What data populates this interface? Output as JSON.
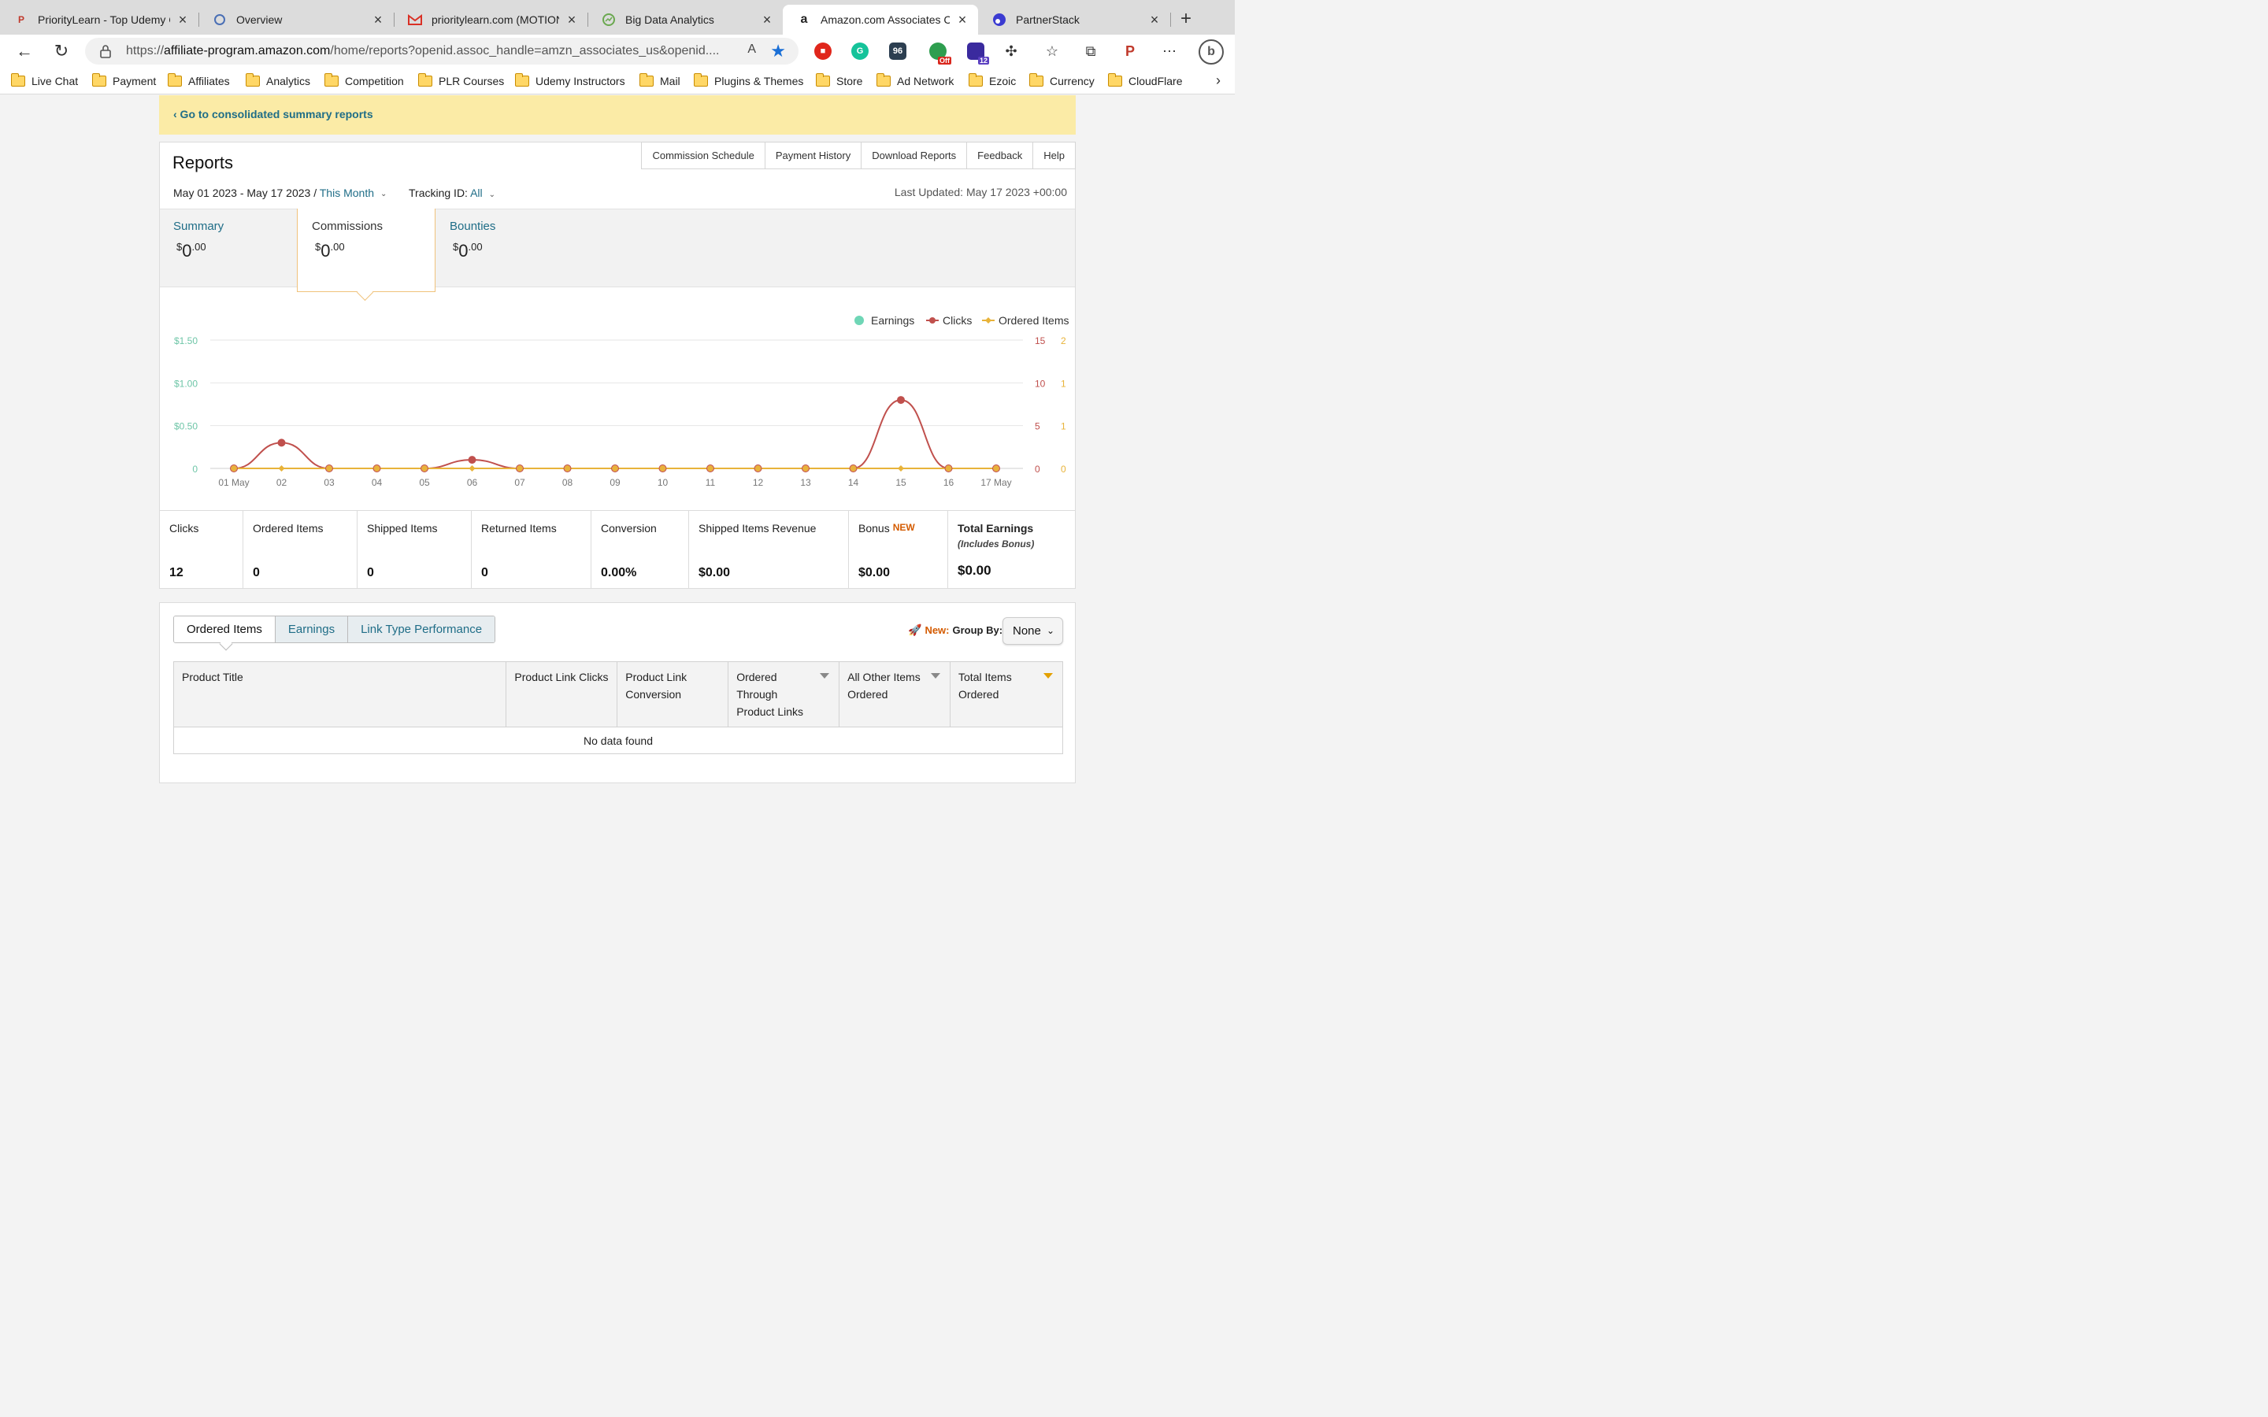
{
  "browser": {
    "tabs": [
      {
        "title": "PriorityLearn - Top Udemy Co",
        "icon": "priority-learn-icon"
      },
      {
        "title": "Overview",
        "icon": "overview-icon"
      },
      {
        "title": "prioritylearn.com (MOTION IN",
        "icon": "gmail-icon"
      },
      {
        "title": "Big Data Analytics",
        "icon": "analytics-icon"
      },
      {
        "title": "Amazon.com Associates Cen",
        "icon": "amazon-icon"
      },
      {
        "title": "PartnerStack",
        "icon": "partnerstack-icon"
      }
    ],
    "url_prefix": "https://",
    "url_domain": "affiliate-program.amazon.com",
    "url_path": "/home/reports?openid.assoc_handle=amzn_associates_us&openid....",
    "ext_badge_96": "96",
    "ext_badge_off": "Off",
    "ext_badge_12": "12",
    "bookmarks": [
      "Live Chat",
      "Payment",
      "Affiliates",
      "Analytics",
      "Competition",
      "PLR Courses",
      "Udemy Instructors",
      "Mail",
      "Plugins & Themes",
      "Store",
      "Ad Network",
      "Ezoic",
      "Currency",
      "CloudFlare"
    ]
  },
  "banner": {
    "link": "‹ Go to consolidated summary reports"
  },
  "reports": {
    "title": "Reports",
    "links": [
      "Commission Schedule",
      "Payment History",
      "Download Reports",
      "Feedback",
      "Help"
    ],
    "date_range": "May 01 2023 - May 17 2023 / ",
    "period": "This Month",
    "tracking_label": "Tracking ID: ",
    "tracking_value": "All",
    "last_updated": "Last Updated: May 17 2023 +00:00",
    "summary_tabs": [
      {
        "label": "Summary",
        "dollars": "0",
        "cents": ".00"
      },
      {
        "label": "Commissions",
        "dollars": "0",
        "cents": ".00"
      },
      {
        "label": "Bounties",
        "dollars": "0",
        "cents": ".00"
      }
    ],
    "currency_symbol": "$"
  },
  "chart_data": {
    "type": "line",
    "x": [
      "01 May",
      "02",
      "03",
      "04",
      "05",
      "06",
      "07",
      "08",
      "09",
      "10",
      "11",
      "12",
      "13",
      "14",
      "15",
      "16",
      "17 May"
    ],
    "series": [
      {
        "name": "Earnings",
        "values": [
          0,
          0,
          0,
          0,
          0,
          0,
          0,
          0,
          0,
          0,
          0,
          0,
          0,
          0,
          0,
          0,
          0
        ],
        "color": "#6fd6b6",
        "axis": "left"
      },
      {
        "name": "Clicks",
        "values": [
          0,
          3,
          0,
          0,
          0,
          1,
          0,
          0,
          0,
          0,
          0,
          0,
          0,
          0,
          8,
          0,
          0
        ],
        "color": "#c0504d",
        "axis": "right1"
      },
      {
        "name": "Ordered Items",
        "values": [
          0,
          0,
          0,
          0,
          0,
          0,
          0,
          0,
          0,
          0,
          0,
          0,
          0,
          0,
          0,
          0,
          0
        ],
        "color": "#e8b33a",
        "axis": "right2"
      }
    ],
    "left_ticks": [
      "0",
      "$0.50",
      "$1.00",
      "$1.50"
    ],
    "right1_ticks": [
      "0",
      "5",
      "10",
      "15"
    ],
    "right2_ticks": [
      "0",
      "1",
      "1",
      "2"
    ],
    "left_range": [
      0,
      1.5
    ],
    "right1_range": [
      0,
      15
    ],
    "legend_position": "top-right",
    "grid": true
  },
  "stats": [
    {
      "label": "Clicks",
      "value": "12"
    },
    {
      "label": "Ordered Items",
      "value": "0"
    },
    {
      "label": "Shipped Items",
      "value": "0"
    },
    {
      "label": "Returned Items",
      "value": "0"
    },
    {
      "label": "Conversion",
      "value": "0.00%"
    },
    {
      "label": "Shipped Items Revenue",
      "value": "$0.00"
    },
    {
      "label": "Bonus",
      "badge": "NEW",
      "value": "$0.00"
    },
    {
      "label": "Total Earnings",
      "sub": "(Includes Bonus)",
      "value": "$0.00"
    }
  ],
  "table_section": {
    "tabs": [
      "Ordered Items",
      "Earnings",
      "Link Type Performance"
    ],
    "new_label": "New:",
    "group_label": " Group By:",
    "group_value": "None",
    "columns": [
      "Product Title",
      "Product Link Clicks",
      "Product Link Conversion",
      "Ordered Through Product Links",
      "All Other Items Ordered",
      "Total Items Ordered"
    ],
    "empty": "No data found"
  }
}
